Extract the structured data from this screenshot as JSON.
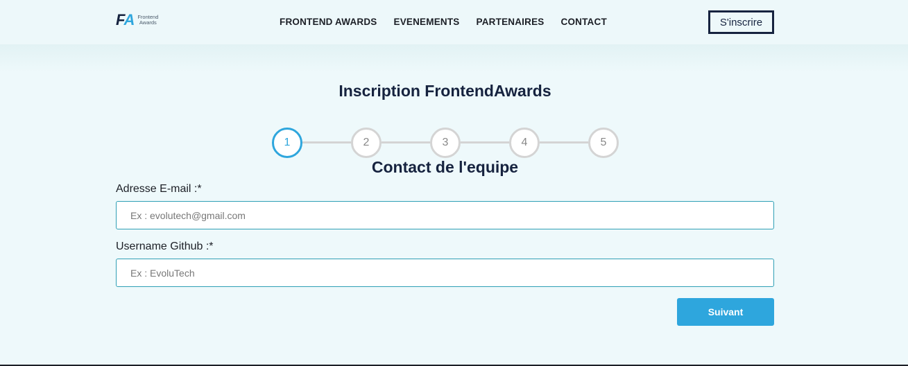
{
  "header": {
    "logo": {
      "mark_f": "F",
      "mark_a": "A",
      "line1": "Frontend",
      "line2": "Awards"
    },
    "nav": [
      "FRONTEND AWARDS",
      "EVENEMENTS",
      "PARTENAIRES",
      "CONTACT"
    ],
    "signup_label": "S'inscrire"
  },
  "main": {
    "title": "Inscription FrontendAwards",
    "steps": [
      "1",
      "2",
      "3",
      "4",
      "5"
    ],
    "active_step": 1,
    "section_title": "Contact de l'equipe",
    "email": {
      "label": "Adresse E-mail :*",
      "placeholder": "Ex : evolutech@gmail.com",
      "value": ""
    },
    "github": {
      "label": "Username Github :*",
      "placeholder": "Ex : EvoluTech",
      "value": ""
    },
    "next_label": "Suivant"
  },
  "colors": {
    "accent": "#2ea6dd",
    "navy": "#16233f",
    "background": "#eef9fb"
  }
}
